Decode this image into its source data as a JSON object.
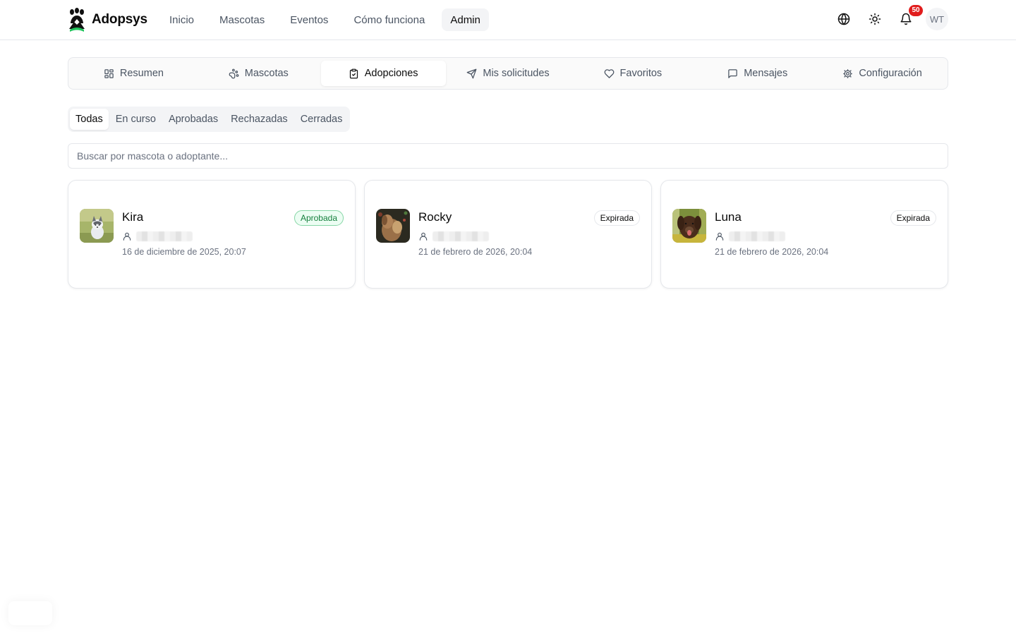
{
  "navbar": {
    "brand": "Adopsys",
    "links": [
      {
        "label": "Inicio",
        "active": false
      },
      {
        "label": "Mascotas",
        "active": false
      },
      {
        "label": "Eventos",
        "active": false
      },
      {
        "label": "Cómo funciona",
        "active": false
      },
      {
        "label": "Admin",
        "active": true
      }
    ],
    "notification_count": "50",
    "user_initials": "WT",
    "icons": [
      "globe-icon",
      "sun-icon",
      "bell-icon"
    ]
  },
  "section_tabs": [
    {
      "label": "Resumen",
      "icon": "dashboard-grid-icon",
      "active": false
    },
    {
      "label": "Mascotas",
      "icon": "paw-icon",
      "active": false
    },
    {
      "label": "Adopciones",
      "icon": "clipboard-check-icon",
      "active": true
    },
    {
      "label": "Mis solicitudes",
      "icon": "send-icon",
      "active": false
    },
    {
      "label": "Favoritos",
      "icon": "heart-icon",
      "active": false
    },
    {
      "label": "Mensajes",
      "icon": "message-square-icon",
      "active": false
    },
    {
      "label": "Configuración",
      "icon": "settings-gear-icon",
      "active": false
    }
  ],
  "filters": [
    {
      "label": "Todas",
      "active": true
    },
    {
      "label": "En curso",
      "active": false
    },
    {
      "label": "Aprobadas",
      "active": false
    },
    {
      "label": "Rechazadas",
      "active": false
    },
    {
      "label": "Cerradas",
      "active": false
    }
  ],
  "search": {
    "placeholder": "Buscar por mascota o adoptante...",
    "value": ""
  },
  "adoptions": [
    {
      "pet": "Kira",
      "status": "Aprobada",
      "status_kind": "approved",
      "date": "16 de diciembre de 2025, 20:07"
    },
    {
      "pet": "Rocky",
      "status": "Expirada",
      "status_kind": "expired",
      "date": "21 de febrero de 2026, 20:04"
    },
    {
      "pet": "Luna",
      "status": "Expirada",
      "status_kind": "expired",
      "date": "21 de febrero de 2026, 20:04"
    }
  ],
  "colors": {
    "approved_badge_bg": "#ecfdf3",
    "approved_badge_text": "#15803d",
    "notification_badge": "#e11d1d",
    "logo_accent": "#22c55e"
  }
}
